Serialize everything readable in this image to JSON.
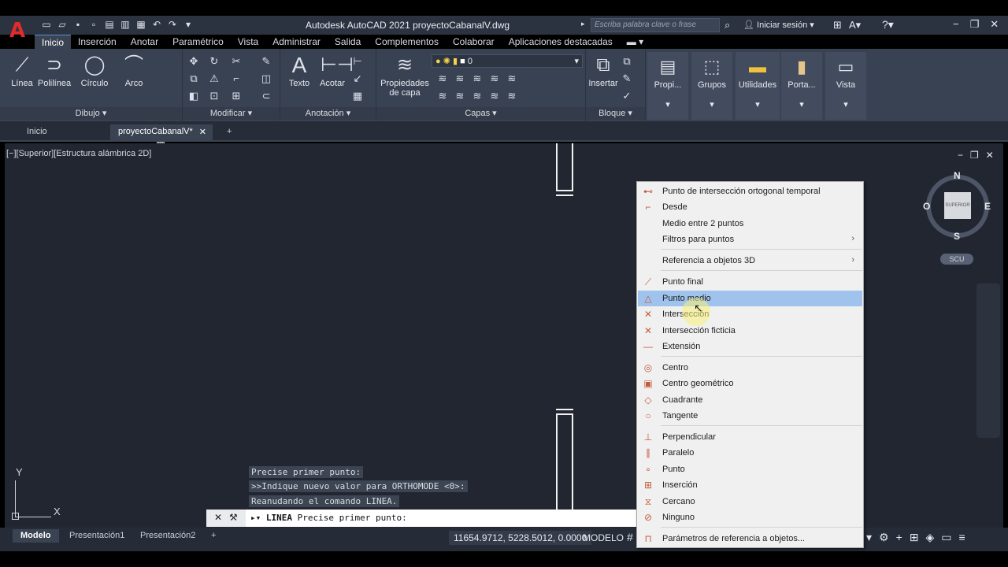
{
  "app": {
    "title": "Autodesk AutoCAD 2021   proyectoCabanalV.dwg",
    "search_placeholder": "Escriba palabra clave o frase",
    "signin": "Iniciar sesión",
    "logo_letter": "A"
  },
  "ribbon_tabs": [
    "Inicio",
    "Inserción",
    "Anotar",
    "Paramétrico",
    "Vista",
    "Administrar",
    "Salida",
    "Complementos",
    "Colaborar",
    "Aplicaciones destacadas"
  ],
  "ribbon": {
    "draw": {
      "title": "Dibujo",
      "linea": "Línea",
      "polilinea": "Polilínea",
      "circulo": "Círculo",
      "arco": "Arco"
    },
    "modify": {
      "title": "Modificar"
    },
    "annotation": {
      "title": "Anotación",
      "texto": "Texto",
      "acotar": "Acotar"
    },
    "layers": {
      "title": "Capas",
      "props": "Propiedades",
      "props2": "de capa",
      "current_layer": "0"
    },
    "block": {
      "title": "Bloque",
      "insertar": "Insertar"
    },
    "tall": {
      "propiedades": "Propi...",
      "grupos": "Grupos",
      "utilidades": "Utilidades",
      "portapapeles": "Porta...",
      "vista": "Vista"
    }
  },
  "doc_tabs": {
    "inicio": "Inicio",
    "file": "proyectoCabanalV*",
    "close": "✕",
    "add": "+"
  },
  "viewport": {
    "label": "[−][Superior][Estructura alámbrica 2D]",
    "compass": {
      "n": "N",
      "s": "S",
      "o": "O",
      "e": "E"
    },
    "cube_label": "SUPERIOR",
    "ucs": "SCU",
    "axis_y": "Y",
    "axis_x": "X"
  },
  "command": {
    "history": [
      "Precise primer punto:",
      ">>Indique nuevo valor para ORTHOMODE <0>:",
      "Reanudando el comando LINEA."
    ],
    "prompt_cmd": "LINEA",
    "prompt_text": "Precise primer punto:"
  },
  "layout_tabs": [
    "Modelo",
    "Presentación1",
    "Presentación2"
  ],
  "status": {
    "coords": "11654.9712, 5228.5012, 0.0000",
    "mode": "MODELO"
  },
  "menu": {
    "items": [
      {
        "label": "Punto de intersección ortogonal temporal",
        "icon": "⊷"
      },
      {
        "label": "Desde",
        "icon": "⌐"
      },
      {
        "label": "Medio entre 2 puntos",
        "icon": ""
      },
      {
        "label": "Filtros para puntos",
        "icon": "",
        "sub": "›"
      },
      {
        "label": "Referencia a objetos 3D",
        "icon": "",
        "sub": "›"
      },
      {
        "label": "Punto final",
        "icon": "⟋"
      },
      {
        "label": "Punto medio",
        "icon": "△"
      },
      {
        "label": "Intersección",
        "icon": "✕"
      },
      {
        "label": "Intersección ficticia",
        "icon": "✕"
      },
      {
        "label": "Extensión",
        "icon": "—"
      },
      {
        "label": "Centro",
        "icon": "◎"
      },
      {
        "label": "Centro geométrico",
        "icon": "▣"
      },
      {
        "label": "Cuadrante",
        "icon": "◇"
      },
      {
        "label": "Tangente",
        "icon": "○"
      },
      {
        "label": "Perpendicular",
        "icon": "⊥"
      },
      {
        "label": "Paralelo",
        "icon": "∥"
      },
      {
        "label": "Punto",
        "icon": "∘"
      },
      {
        "label": "Inserción",
        "icon": "⊞"
      },
      {
        "label": "Cercano",
        "icon": "⧖"
      },
      {
        "label": "Ninguno",
        "icon": "⊘"
      },
      {
        "label": "Parámetros de referencia a objetos...",
        "icon": "⊓"
      }
    ]
  }
}
